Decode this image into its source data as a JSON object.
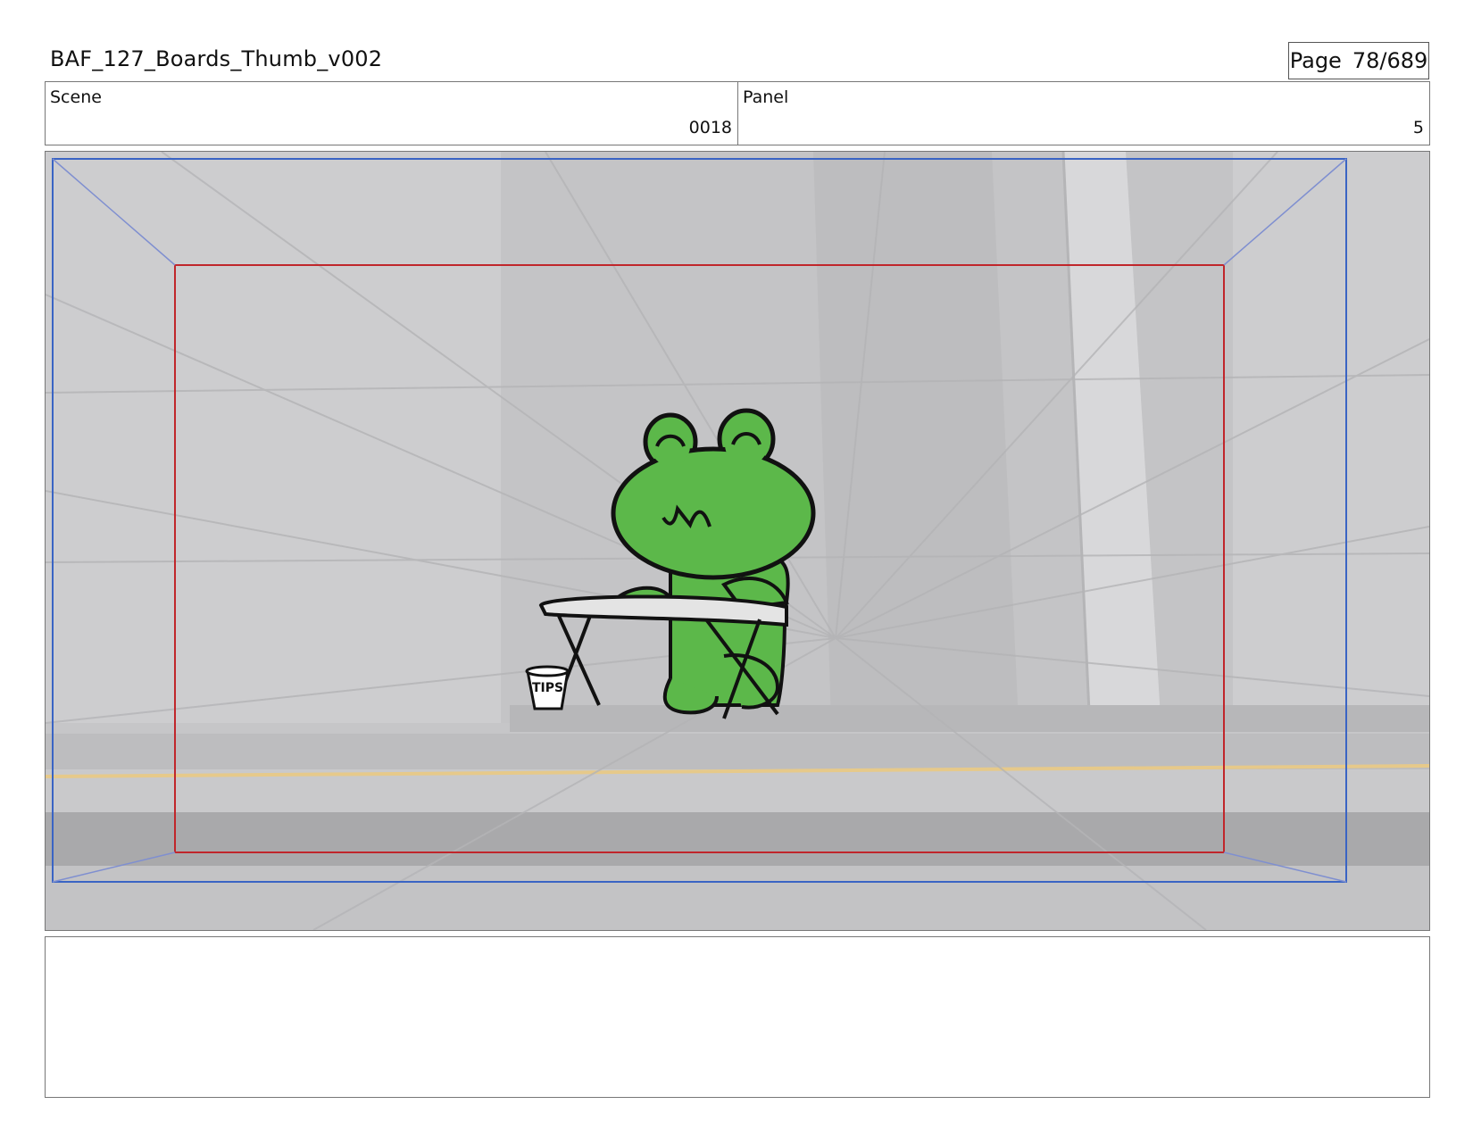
{
  "header": {
    "title": "BAF_127_Boards_Thumb_v002",
    "page_label": "Page",
    "page_number": "78/689"
  },
  "info": {
    "scene_label": "Scene",
    "scene_value": "0018",
    "panel_label": "Panel",
    "panel_value": "5"
  },
  "drawing": {
    "tip_jar_text": "TIPS",
    "colors": {
      "frog_green": "#5cb84a",
      "safe_area": "#c0262b",
      "camera_frame": "#3a64c4",
      "road_line": "#e6c98a",
      "background": "#cdcdcf"
    }
  },
  "notes": {
    "text": ""
  }
}
